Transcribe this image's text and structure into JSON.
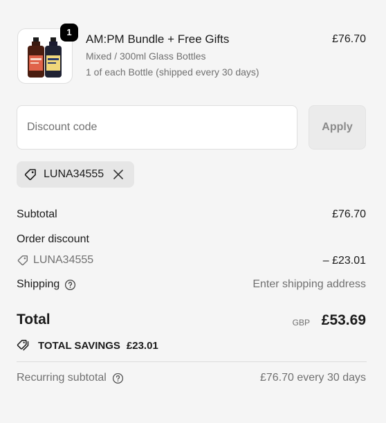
{
  "product": {
    "quantity": "1",
    "name": "AM:PM Bundle + Free Gifts",
    "variant": "Mixed / 300ml Glass Bottles",
    "subscription": "1 of each Bottle (shipped every 30 days)",
    "price": "£76.70"
  },
  "discount": {
    "placeholder": "Discount code",
    "apply_label": "Apply",
    "applied_code": "LUNA34555"
  },
  "summary": {
    "subtotal_label": "Subtotal",
    "subtotal_value": "£76.70",
    "order_discount_label": "Order discount",
    "discount_code": "LUNA34555",
    "discount_value": "– £23.01",
    "shipping_label": "Shipping",
    "shipping_value": "Enter shipping address",
    "total_label": "Total",
    "currency": "GBP",
    "total_value": "£53.69",
    "savings_label": "TOTAL SAVINGS",
    "savings_value": "£23.01",
    "recurring_label": "Recurring subtotal",
    "recurring_value": "£76.70 every 30 days"
  },
  "icons": {
    "tag": "tag-icon",
    "close": "close-icon",
    "help": "question-circle-icon",
    "savings": "tags-icon"
  }
}
